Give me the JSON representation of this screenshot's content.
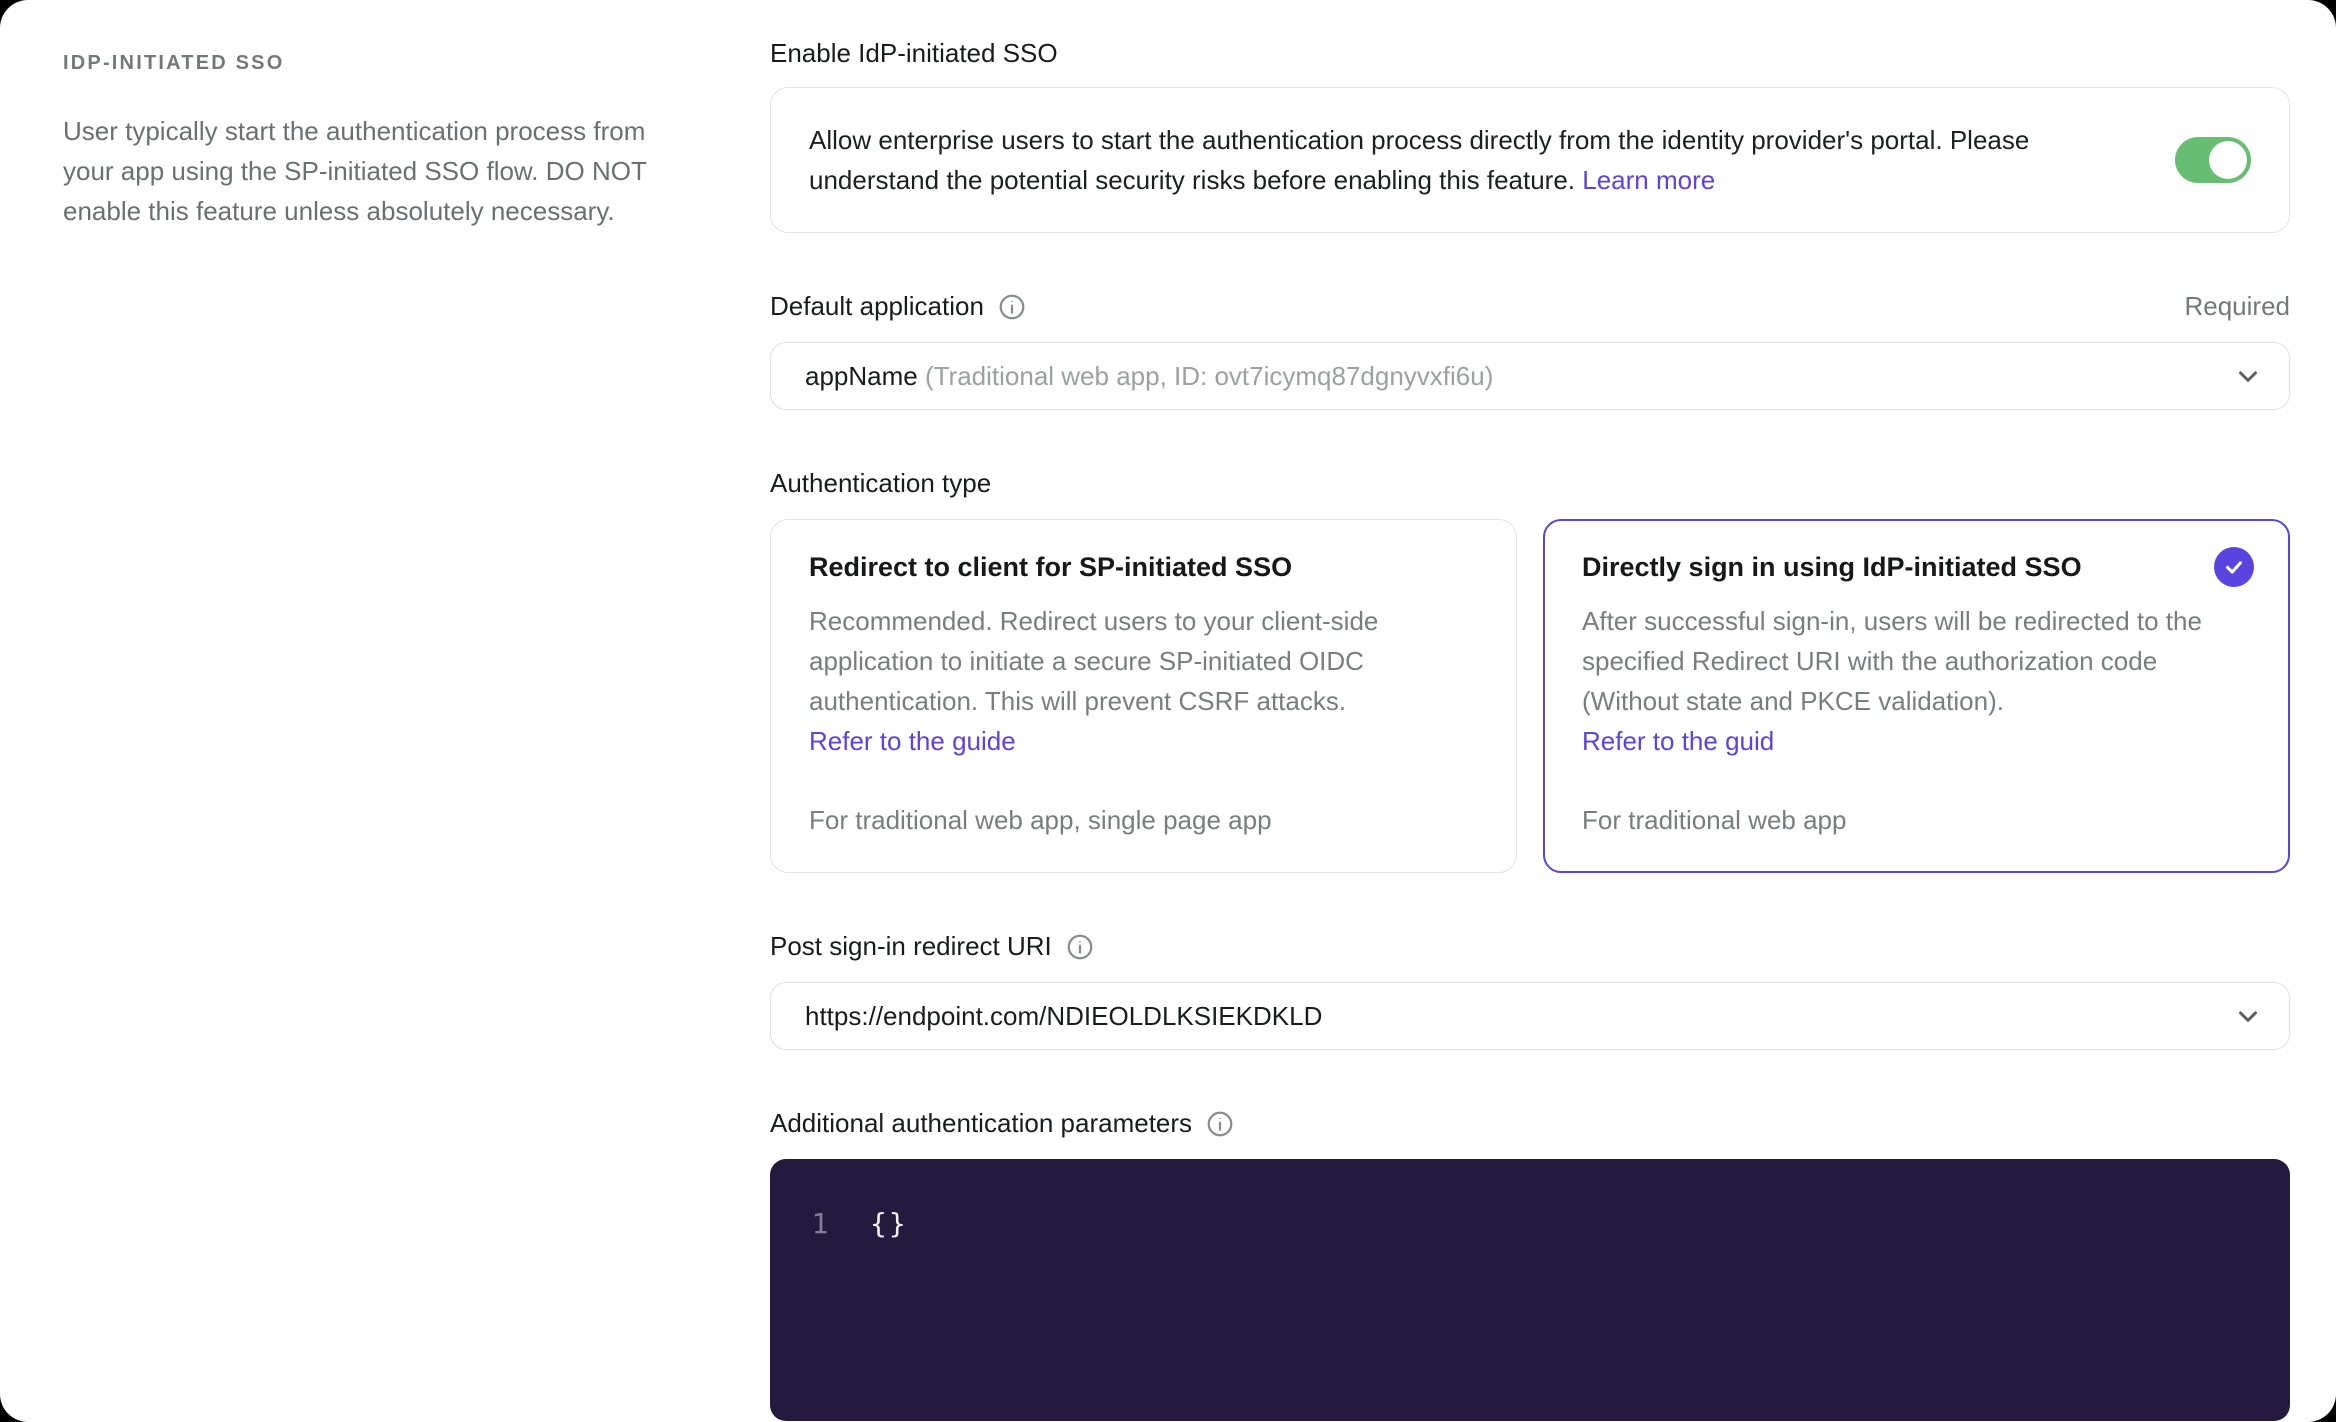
{
  "sidebar": {
    "title": "IDP-INITIATED SSO",
    "description": "User typically start the authentication process from your app using the SP-initiated SSO flow. DO NOT enable this feature unless absolutely necessary."
  },
  "enable": {
    "label": "Enable IdP-initiated SSO",
    "description": "Allow enterprise users to start the authentication process directly from the identity provider's portal. Please understand the potential security risks before enabling this feature.",
    "link_label": "Learn more",
    "toggle_state": "on"
  },
  "default_app": {
    "label": "Default application",
    "required_label": "Required",
    "selected_value_primary": "appName",
    "selected_value_secondary": "(Traditional web app, ID: ovt7icymq87dgnyvxfi6u)"
  },
  "auth_type": {
    "label": "Authentication type",
    "options": [
      {
        "title": "Redirect to client for SP-initiated SSO",
        "description": "Recommended. Redirect users to your client-side application to initiate a secure SP-initiated OIDC authentication. This will prevent CSRF attacks.",
        "link_label": "Refer to the guide",
        "footer": "For traditional web app, single page app",
        "selected": false
      },
      {
        "title": "Directly sign in using IdP-initiated SSO",
        "description": "After successful sign-in, users will be redirected to the specified Redirect URI with the authorization code (Without state and PKCE validation).",
        "link_label": "Refer to the guid",
        "footer": "For traditional web app",
        "selected": true
      }
    ]
  },
  "redirect_uri": {
    "label": "Post sign-in redirect URI",
    "selected_value": "https://endpoint.com/NDIEOLDLKSIEKDKLD"
  },
  "auth_params": {
    "label": "Additional authentication parameters",
    "line_number": "1",
    "code": "{}"
  },
  "colors": {
    "accent_purple": "#5b43e0",
    "toggle_green": "#67be73",
    "editor_background": "#231a3e",
    "surface": "#ffffff",
    "border": "#e2e4e5",
    "text_primary": "#191c1d",
    "text_secondary": "#75787a"
  }
}
